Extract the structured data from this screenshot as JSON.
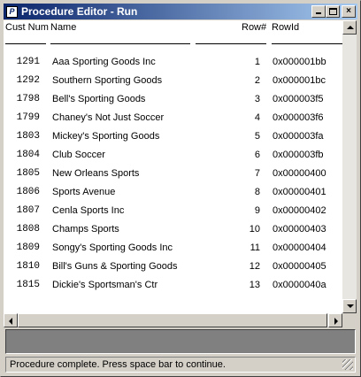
{
  "window": {
    "title": "Procedure Editor - Run",
    "app_icon_letter": "P"
  },
  "titlebar_buttons": {
    "close_glyph": "×"
  },
  "table": {
    "headers": {
      "cust_num": "Cust Num",
      "name": "Name",
      "row_num": "Row#",
      "row_id": "RowId"
    },
    "rows": [
      {
        "cust_num": "1291",
        "name": "Aaa Sporting Goods Inc",
        "row_num": "1",
        "row_id": "0x000001bb"
      },
      {
        "cust_num": "1292",
        "name": "Southern Sporting Goods",
        "row_num": "2",
        "row_id": "0x000001bc"
      },
      {
        "cust_num": "1798",
        "name": "Bell's Sporting Goods",
        "row_num": "3",
        "row_id": "0x000003f5"
      },
      {
        "cust_num": "1799",
        "name": "Chaney's Not Just Soccer",
        "row_num": "4",
        "row_id": "0x000003f6"
      },
      {
        "cust_num": "1803",
        "name": "Mickey's Sporting Goods",
        "row_num": "5",
        "row_id": "0x000003fa"
      },
      {
        "cust_num": "1804",
        "name": "Club Soccer",
        "row_num": "6",
        "row_id": "0x000003fb"
      },
      {
        "cust_num": "1805",
        "name": "New Orleans Sports",
        "row_num": "7",
        "row_id": "0x00000400"
      },
      {
        "cust_num": "1806",
        "name": "Sports Avenue",
        "row_num": "8",
        "row_id": "0x00000401"
      },
      {
        "cust_num": "1807",
        "name": "Cenla Sports Inc",
        "row_num": "9",
        "row_id": "0x00000402"
      },
      {
        "cust_num": "1808",
        "name": "Champs Sports",
        "row_num": "10",
        "row_id": "0x00000403"
      },
      {
        "cust_num": "1809",
        "name": "Songy's Sporting Goods Inc",
        "row_num": "11",
        "row_id": "0x00000404"
      },
      {
        "cust_num": "1810",
        "name": "Bill's Guns & Sporting Goods",
        "row_num": "12",
        "row_id": "0x00000405"
      },
      {
        "cust_num": "1815",
        "name": "Dickie's Sportsman's Ctr",
        "row_num": "13",
        "row_id": "0x0000040a"
      }
    ]
  },
  "status": {
    "text": "Procedure complete. Press space bar to continue."
  },
  "colors": {
    "titlebar_start": "#0a246a",
    "titlebar_end": "#a6caf0",
    "face": "#d4d0c8"
  }
}
